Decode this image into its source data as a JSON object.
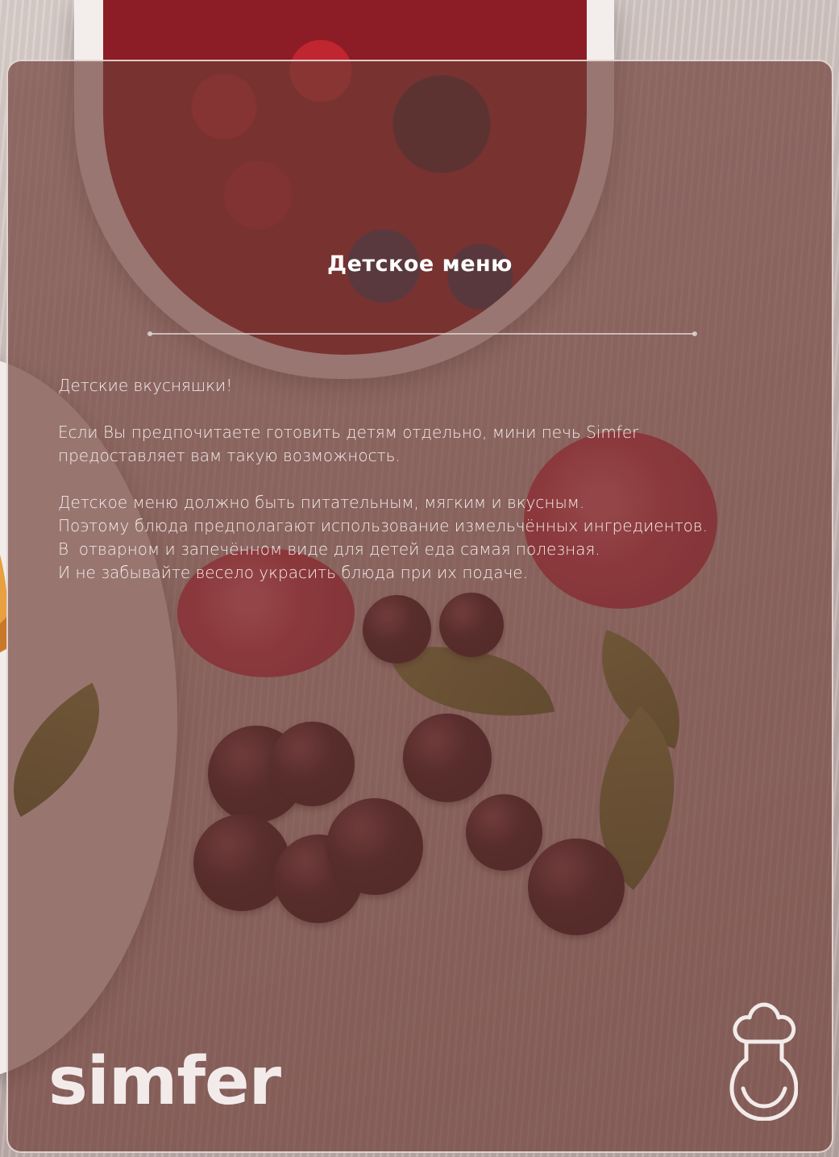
{
  "page": {
    "title": "Детское меню",
    "paragraphs": [
      [
        "Детские вкусняшки!"
      ],
      [
        "Если Вы предпочитаете готовить детям отдельно, мини печь Simfer",
        "предоставляет вам такую возможность."
      ],
      [
        "Детское меню должно быть питательным, мягким и вкусным.",
        "Поэтому блюда предполагают использование измельчённых ингредиентов.",
        "В  отварном и запечённом виде для детей еда самая полезная.",
        "И не забывайте весело украсить блюда при их подаче."
      ]
    ]
  },
  "brand": {
    "logo_text": "simfer",
    "icon": "chef-hat-icon"
  },
  "colors": {
    "overlay": "#6e3c36",
    "text": "#f3ecea",
    "border": "#f0e6e4"
  }
}
